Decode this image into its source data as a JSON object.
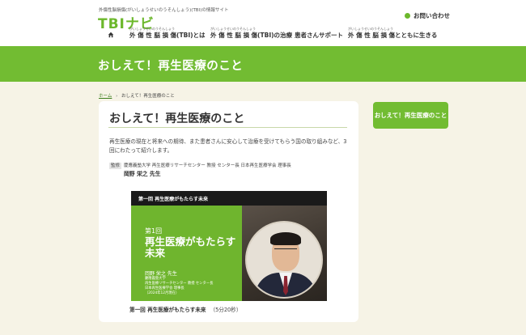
{
  "header": {
    "tagline": "外傷性脳損傷(がいしょうせいのうそんしょう)(TBI)の情報サイト",
    "logo": "TBIナビ",
    "contact_label": "お問い合わせ"
  },
  "nav": {
    "items": [
      {
        "ruby": "",
        "label": ""
      },
      {
        "ruby": "がいしょうせいのうそんしょう",
        "label": "外 傷 性 脳 損 傷(TBI)とは"
      },
      {
        "ruby": "がいしょうせいのうそんしょう",
        "label": "外 傷 性 脳 損 傷(TBI)の治療"
      },
      {
        "ruby": "",
        "label": "患者さんサポート"
      },
      {
        "ruby": "がいしょうせいのうそんしょう",
        "label": "外 傷 性 脳 損 傷とともに生きる"
      }
    ]
  },
  "banner": {
    "title": "おしえて！再生医療のこと"
  },
  "breadcrumb": {
    "home": "ホーム",
    "separator": "›",
    "current": "おしえて！再生医療のこと"
  },
  "article": {
    "title": "おしえて！再生医療のこと",
    "intro": "再生医療の現在と将来への期待、また患者さんに安心して治療を受けてもらう国の取り組みなど、3回にわたって紹介します。",
    "supervisor_tag": "監修",
    "supervisor_affiliation": "慶應義塾大学 再生医療リサーチセンター 教授 センター長 日本再生医療学会 理事長",
    "supervisor_name": "岡野 栄之 先生"
  },
  "video": {
    "topbar": "第一回 再生医療がもたらす未来",
    "episode": "第1回",
    "title": "再生医療がもたらす未来",
    "presenter": "岡野 栄之 先生",
    "affiliation": "慶應義塾大学\n再生医療リサーチセンター 教授 センター長\n日本再生医療学会 理事長\n（2024年12月現在）",
    "caption_title": "第一回 再生医療がもたらす未来",
    "caption_duration": "（5分20秒）"
  },
  "sidebar": {
    "button_label": "おしえて！再生医療のこと"
  },
  "colors": {
    "brand_green": "#72bc32",
    "background": "#f6f3e6"
  }
}
